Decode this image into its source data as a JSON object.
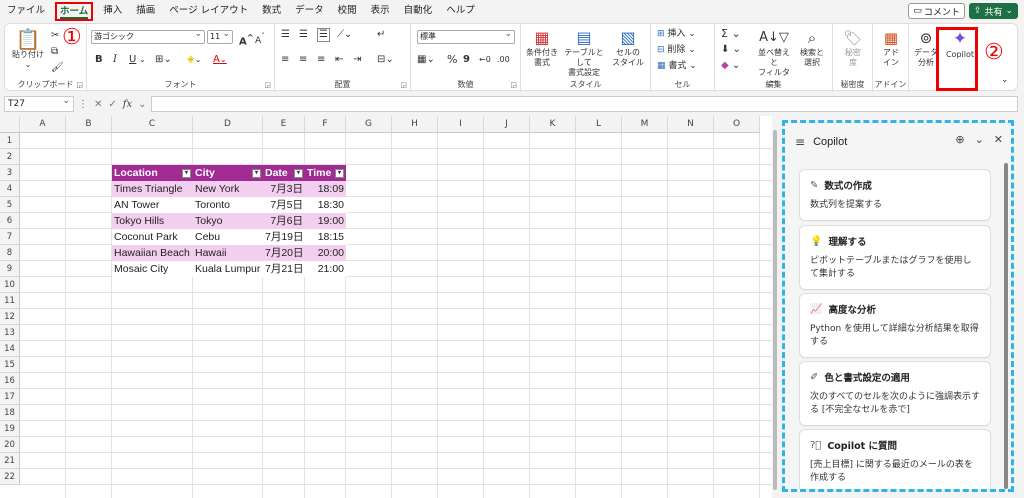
{
  "menu": [
    "ファイル",
    "ホーム",
    "挿入",
    "描画",
    "ページ レイアウト",
    "数式",
    "データ",
    "校閲",
    "表示",
    "自動化",
    "ヘルプ"
  ],
  "active_menu_index": 1,
  "annotations": {
    "step1": "①",
    "step2": "②"
  },
  "top_right": {
    "comment": "コメント",
    "share": "共有"
  },
  "ribbon": {
    "clipboard": {
      "label": "クリップボード",
      "paste": "貼り付け"
    },
    "font": {
      "label": "フォント",
      "font_name": "游ゴシック",
      "font_size": "11",
      "bold": "B",
      "italic": "I",
      "underline": "U",
      "grow": "A",
      "shrink": "A"
    },
    "alignment": {
      "label": "配置"
    },
    "number": {
      "label": "数値",
      "format": "標準"
    },
    "styles": {
      "label": "スタイル",
      "conditional": "条件付き\n書式",
      "table": "テーブルとして\n書式設定",
      "cell_style": "セルの\nスタイル"
    },
    "cells": {
      "label": "セル",
      "insert": "挿入",
      "delete": "削除",
      "format": "書式"
    },
    "editing": {
      "label": "編集",
      "sort": "並べ替えと\nフィルター",
      "find": "検索と\n選択"
    },
    "sensitivity": {
      "label": "秘密度",
      "btn": "秘密\n度"
    },
    "addins": {
      "label": "アドイン",
      "btn": "アド\nイン"
    },
    "analyze": {
      "btn": "データ\n分析"
    },
    "copilot": {
      "btn": "Copilot"
    }
  },
  "formula_bar": {
    "name_box": "T27",
    "fx": "fx"
  },
  "columns": [
    "A",
    "B",
    "C",
    "D",
    "E",
    "F",
    "G",
    "H",
    "I",
    "J",
    "K",
    "L",
    "M",
    "N",
    "O"
  ],
  "rows": [
    "1",
    "2",
    "3",
    "4",
    "5",
    "6",
    "7",
    "8",
    "9",
    "10",
    "11",
    "12",
    "13",
    "14",
    "15",
    "16",
    "17",
    "18",
    "19",
    "20",
    "21",
    "22"
  ],
  "table": {
    "headers": [
      "Location",
      "City",
      "Date",
      "Time"
    ],
    "rows": [
      [
        "Times Triangle",
        "New York",
        "7月3日",
        "18:09"
      ],
      [
        "AN Tower",
        "Toronto",
        "7月5日",
        "18:30"
      ],
      [
        "Tokyo Hills",
        "Tokyo",
        "7月6日",
        "19:00"
      ],
      [
        "Coconut Park",
        "Cebu",
        "7月19日",
        "18:15"
      ],
      [
        "Hawaiian Beach",
        "Hawaii",
        "7月20日",
        "20:00"
      ],
      [
        "Mosaic City",
        "Kuala Lumpur",
        "7月21日",
        "21:00"
      ]
    ],
    "header_color": "#a02b93",
    "band_color": "#f2cfee"
  },
  "copilot_pane": {
    "title": "Copilot",
    "cards": [
      {
        "icon": "formula-icon",
        "title": "数式の作成",
        "desc": "数式列を提案する"
      },
      {
        "icon": "lightbulb-icon",
        "title": "理解する",
        "desc": "ピボットテーブルまたはグラフを使用して集計する"
      },
      {
        "icon": "chart-icon",
        "title": "高度な分析",
        "desc": "Python を使用して詳細な分析結果を取得する"
      },
      {
        "icon": "pen-icon",
        "title": "色と書式設定の適用",
        "desc": "次のすべてのセルを次のように強調表示する [不完全なセルを赤で]"
      },
      {
        "icon": "question-icon",
        "title": "Copilot に質問",
        "desc": "[売上目標] に関する最近のメールの表を作成する"
      }
    ]
  }
}
